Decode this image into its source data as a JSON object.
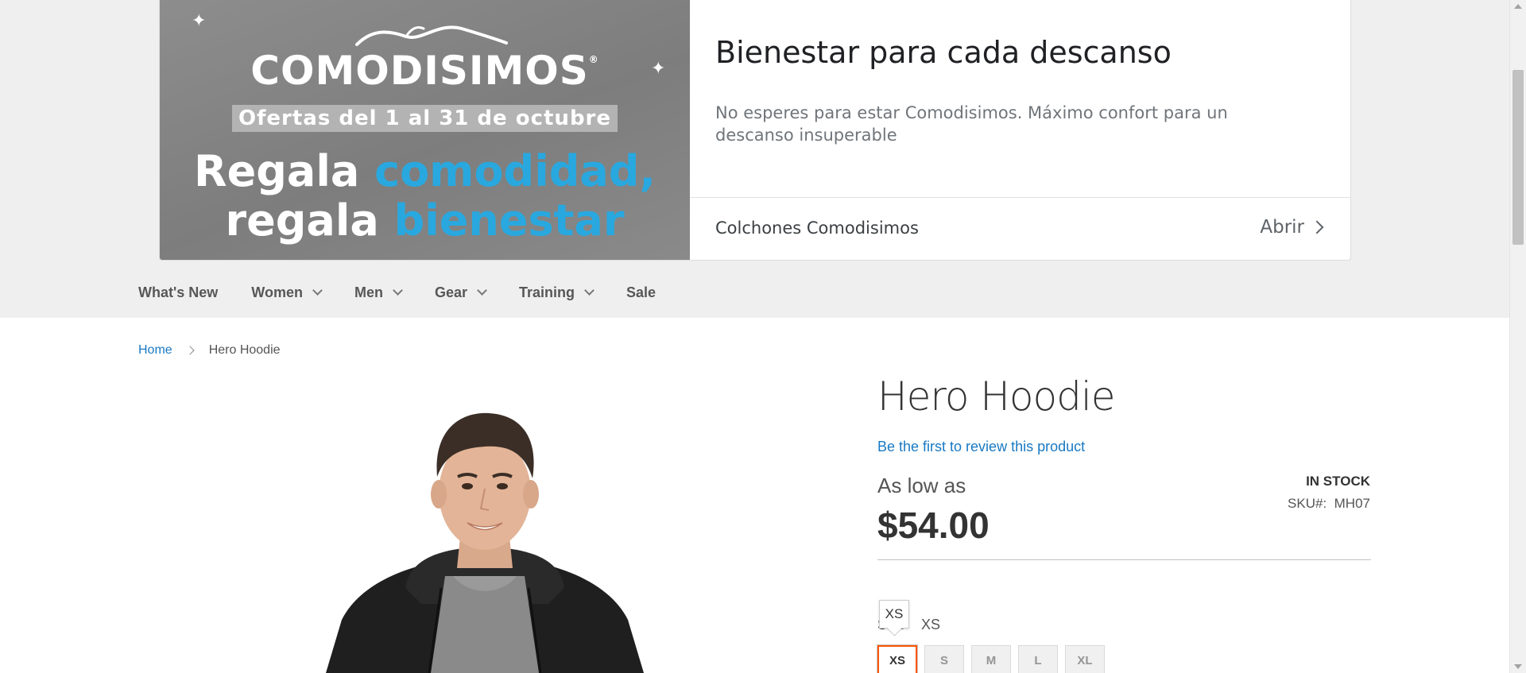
{
  "ad": {
    "brand": "COMODISIMOS",
    "brand_mark": "®",
    "offer": "Ofertas del 1 al 31 de octubre",
    "line1_white": "Regala ",
    "line1_blue": "comodidad,",
    "line2_white": "regala ",
    "line2_blue": "bienestar",
    "title": "Bienestar para cada descanso",
    "description": "No esperes para estar Comodisimos. Máximo confort para un descanso insuperable",
    "advertiser": "Colchones Comodisimos",
    "open_label": "Abrir",
    "accent_color": "#29a8df"
  },
  "nav": {
    "items": [
      {
        "label": "What's New",
        "dropdown": false
      },
      {
        "label": "Women",
        "dropdown": true
      },
      {
        "label": "Men",
        "dropdown": true
      },
      {
        "label": "Gear",
        "dropdown": true
      },
      {
        "label": "Training",
        "dropdown": true
      },
      {
        "label": "Sale",
        "dropdown": false
      }
    ]
  },
  "breadcrumb": {
    "home": "Home",
    "current": "Hero Hoodie"
  },
  "product": {
    "name": "Hero Hoodie",
    "review_link": "Be the first to review this product",
    "price_prefix": "As low as",
    "price": "$54.00",
    "stock": "IN STOCK",
    "sku_label": "SKU#:",
    "sku": "MH07",
    "size_label": "Size",
    "selected_size": "XS",
    "tooltip": "XS",
    "sizes": [
      "XS",
      "S",
      "M",
      "L",
      "XL"
    ]
  }
}
